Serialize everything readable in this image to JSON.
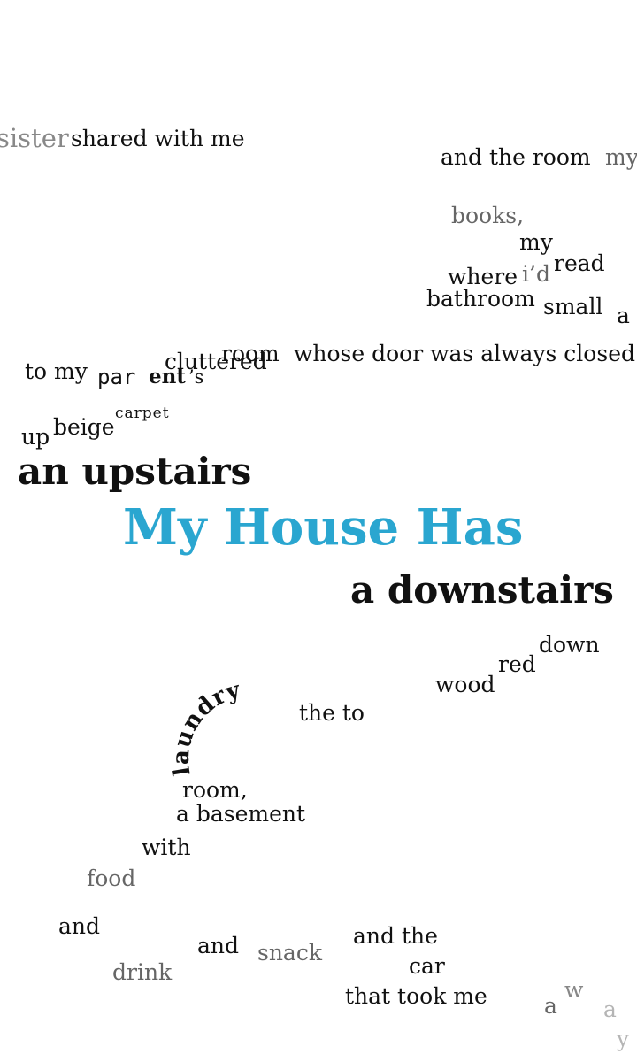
{
  "title": "My House Has",
  "upstairs": {
    "heading": "an upstairs",
    "phrases": {
      "sister": "sister",
      "shared_with_me": "shared with me",
      "and_the_room": "and the room",
      "my_1": "my",
      "books": "books,",
      "my_2": "my",
      "read": "read",
      "where": "where",
      "id": "i’d",
      "bathroom": "bathroom",
      "small": "small",
      "a": "a",
      "whose_door": "whose door was always closed",
      "room": "room",
      "cluttered": "cluttered",
      "to_my": "to my",
      "par": "par",
      "ent": "ent",
      "s": "’s",
      "up": "up",
      "beige": "beige",
      "carpet": "carpet"
    }
  },
  "downstairs": {
    "heading": "a downstairs",
    "phrases": {
      "down": "down",
      "red": "red",
      "wood": "wood",
      "the_to": "the to",
      "laundry": "laundry",
      "room_comma": "room,",
      "a_basement": "a basement",
      "with": "with",
      "food": "food",
      "and_1": "and",
      "drink": "drink",
      "and_2": "and",
      "snack": "snack",
      "and_the": "and the",
      "car": "car",
      "that_took_me": "that took me",
      "away_a": "a",
      "away_w": "w",
      "away_a2": "a",
      "away_y": "y"
    }
  },
  "colors": {
    "title": "#2aa6d0",
    "text": "#111111",
    "gray": "#666666",
    "light_gray": "#888888",
    "lighter_gray": "#b5b5b5"
  }
}
